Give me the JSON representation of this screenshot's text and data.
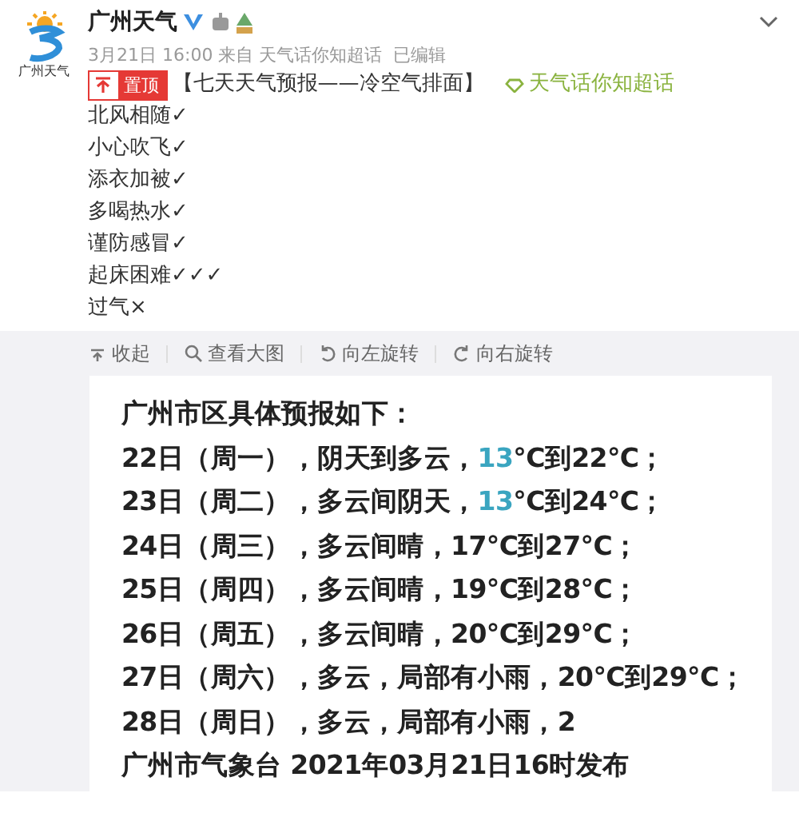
{
  "author": {
    "avatar_caption": "广州天气",
    "name": "广州天气",
    "meta": "3月21日 16:00 来自 天气话你知超话",
    "edited": "已编辑"
  },
  "pin": {
    "label": "置顶"
  },
  "title": "【七天天气预报——冷空气排面】",
  "topic": "天气话你知超话",
  "lines": [
    "北风相随✓",
    "小心吹飞✓",
    "添衣加被✓",
    "多喝热水✓",
    "谨防感冒✓",
    "起床困难✓✓✓",
    "过气×"
  ],
  "toolbar": [
    {
      "kind": "collapse",
      "label": "收起"
    },
    {
      "kind": "zoom",
      "label": "查看大图"
    },
    {
      "kind": "rotate-left",
      "label": "向左旋转"
    },
    {
      "kind": "rotate-right",
      "label": "向右旋转"
    }
  ],
  "forecast": {
    "heading": "广州市区具体预报如下：",
    "lines": [
      [
        {
          "text": "22日（周一），阴天到多云，",
          "highlight": false
        },
        {
          "text": "13",
          "highlight": true
        },
        {
          "text": "°C到22°C；",
          "highlight": false
        }
      ],
      [
        {
          "text": "23日（周二），多云间阴天，",
          "highlight": false
        },
        {
          "text": "13",
          "highlight": true
        },
        {
          "text": "°C到24°C；",
          "highlight": false
        }
      ],
      [
        {
          "text": "24日（周三），多云间晴，17°C到27°C；",
          "highlight": false
        }
      ],
      [
        {
          "text": "25日（周四），多云间晴，19°C到28°C；",
          "highlight": false
        }
      ],
      [
        {
          "text": "26日（周五），多云间晴，20°C到29°C；",
          "highlight": false
        }
      ],
      [
        {
          "text": "27日（周六），多云，局部有小雨，20°C到29°C；",
          "highlight": false
        }
      ],
      [
        {
          "text": "28日（周日），多云，局部有小雨，2",
          "highlight": false
        }
      ]
    ],
    "footer": "广州市气象台 2021年03月21日16时发布"
  }
}
